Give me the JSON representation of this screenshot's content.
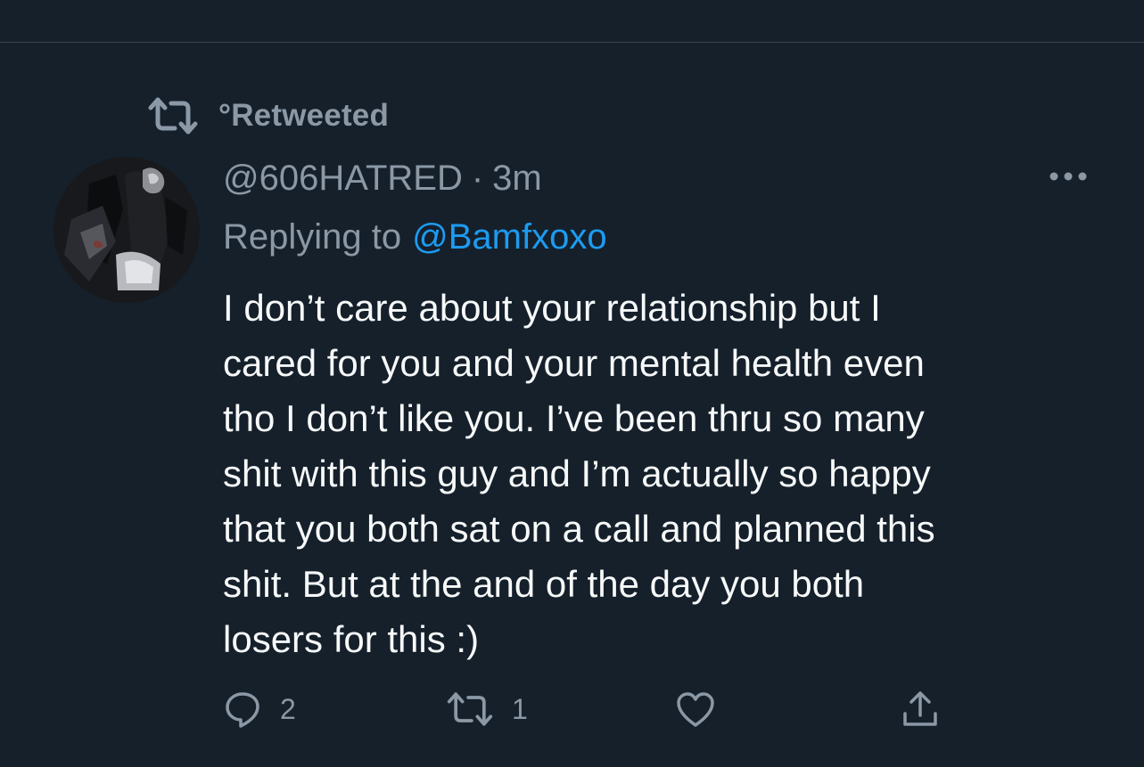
{
  "retweet": {
    "icon": "retweet-icon",
    "label": "°Retweeted"
  },
  "tweet": {
    "avatar_icon": "avatar-image",
    "handle": "@606HATRED",
    "separator": "·",
    "time": "3m",
    "more_icon": "more-options-icon",
    "replying_to_label": "Replying to",
    "replying_to_handle": "@Bamfxoxo",
    "text_lines": [
      "I don’t care about your relationship but I",
      "cared for you and your mental health even",
      "tho I don’t like you. I’ve been thru so many",
      "shit with this guy and I’m actually so happy",
      "that you both sat on a call and planned this",
      "shit. But at the and of the day you both",
      "losers for this :)"
    ]
  },
  "actions": {
    "reply": {
      "icon": "reply-icon",
      "count": "2"
    },
    "retweet": {
      "icon": "retweet-icon",
      "count": "1"
    },
    "like": {
      "icon": "heart-icon",
      "count": ""
    },
    "share": {
      "icon": "share-icon",
      "count": ""
    }
  },
  "colors": {
    "background": "#15202b",
    "secondary_text": "#8b98a5",
    "primary_text": "#f7f9f9",
    "link": "#1d9bf0",
    "divider": "#38444d"
  }
}
